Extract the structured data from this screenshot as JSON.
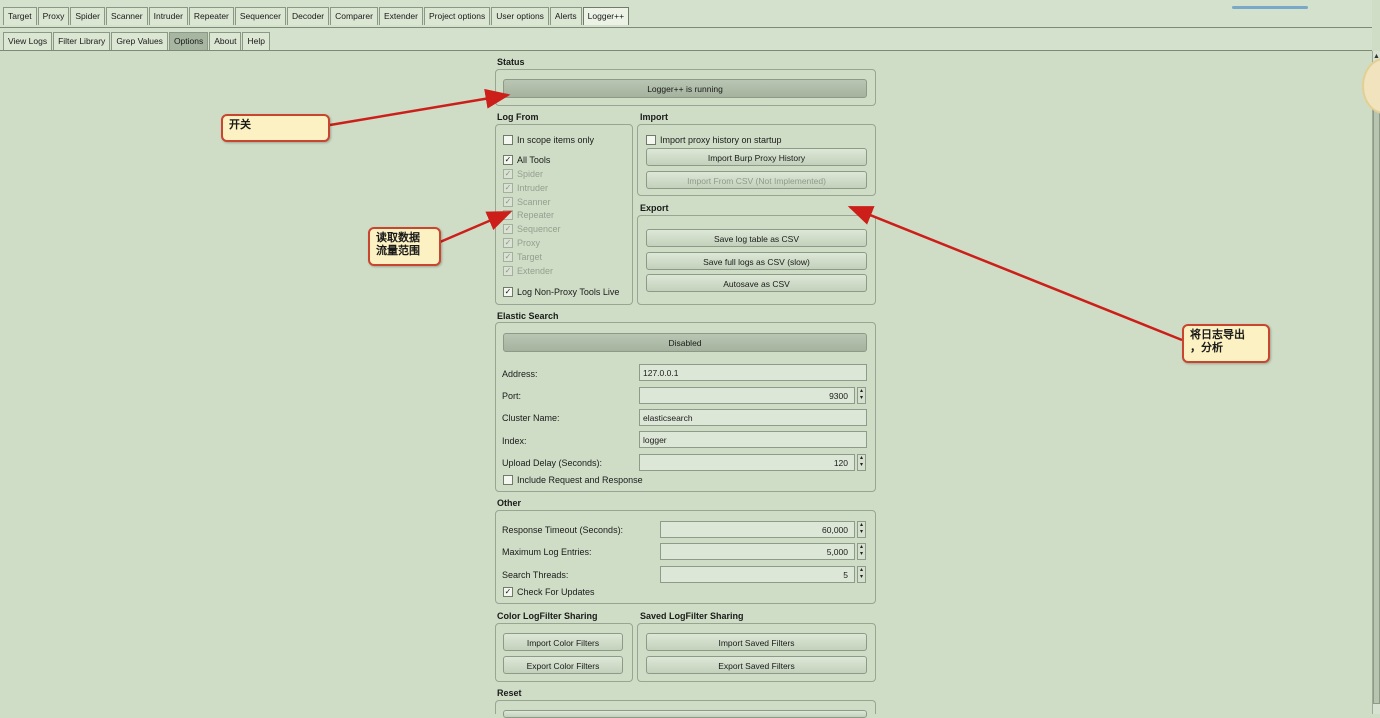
{
  "top_tabs": [
    "Target",
    "Proxy",
    "Spider",
    "Scanner",
    "Intruder",
    "Repeater",
    "Sequencer",
    "Decoder",
    "Comparer",
    "Extender",
    "Project options",
    "User options",
    "Alerts",
    "Logger++"
  ],
  "sub_tabs": [
    "View Logs",
    "Filter Library",
    "Grep Values",
    "Options",
    "About",
    "Help"
  ],
  "status": {
    "title": "Status",
    "button": "Logger++ is running"
  },
  "log_from": {
    "title": "Log From",
    "in_scope": "In scope items only",
    "all_tools": "All Tools",
    "tools": [
      "Spider",
      "Intruder",
      "Scanner",
      "Repeater",
      "Sequencer",
      "Proxy",
      "Target",
      "Extender"
    ],
    "non_proxy": "Log Non-Proxy Tools Live"
  },
  "import": {
    "title": "Import",
    "on_startup": "Import proxy history on startup",
    "burp_btn": "Import Burp Proxy History",
    "csv_btn": "Import From CSV (Not Implemented)"
  },
  "export": {
    "title": "Export",
    "save_table": "Save log table as CSV",
    "save_full": "Save full logs as CSV (slow)",
    "autosave": "Autosave as CSV"
  },
  "elastic": {
    "title": "Elastic Search",
    "button": "Disabled",
    "address_label": "Address:",
    "address": "127.0.0.1",
    "port_label": "Port:",
    "port": "9300",
    "cluster_label": "Cluster Name:",
    "cluster": "elasticsearch",
    "index_label": "Index:",
    "index": "logger",
    "delay_label": "Upload Delay (Seconds):",
    "delay": "120",
    "include": "Include Request and Response"
  },
  "other": {
    "title": "Other",
    "timeout_label": "Response Timeout (Seconds):",
    "timeout": "60,000",
    "max_label": "Maximum Log Entries:",
    "max": "5,000",
    "threads_label": "Search Threads:",
    "threads": "5",
    "updates": "Check For Updates"
  },
  "color_sharing": {
    "title": "Color LogFilter Sharing",
    "import": "Import Color Filters",
    "export": "Export Color Filters"
  },
  "saved_sharing": {
    "title": "Saved LogFilter Sharing",
    "import": "Import Saved Filters",
    "export": "Export Saved Filters"
  },
  "reset": {
    "title": "Reset"
  },
  "annotations": {
    "switch": "开关",
    "scope": "读取数据\n流量范围",
    "export": "将日志导出\n，分析"
  },
  "colors": {
    "background": "#cfddc6",
    "annotation_border": "#c8452f",
    "annotation_fill": "#fbf1c2",
    "arrow": "#cc1f1a"
  }
}
